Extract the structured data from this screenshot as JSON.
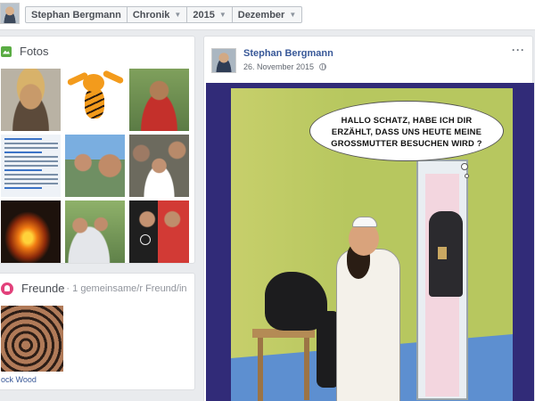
{
  "topbar": {
    "name": "Stephan Bergmann",
    "section": "Chronik",
    "year": "2015",
    "month": "Dezember"
  },
  "photos": {
    "title": "Fotos",
    "tiles": [
      "photo-portrait",
      "photo-tigger",
      "photo-red-shirt",
      "photo-tweet",
      "photo-selfie",
      "photo-group",
      "photo-fire",
      "photo-group-outdoor",
      "photo-two-men"
    ]
  },
  "friends": {
    "title": "Freunde",
    "meta": "· 1 gemeinsame/r Freund/in",
    "friend_name": "ock Wood"
  },
  "post": {
    "author": "Stephan Bergmann",
    "date": "26. November 2015",
    "more": "···",
    "bubble_text": "HALLO SCHATZ, HABE ICH DIR ERZÄHLT, DASS UNS HEUTE MEINE GROSSMUTTER BESUCHEN WIRD ?"
  },
  "icons": {
    "photos": "photos-icon",
    "friends": "friends-icon",
    "privacy": "globe-icon",
    "menu": "more-options-icon"
  },
  "colors": {
    "link_blue": "#385898",
    "page_bg": "#e9ebee",
    "photos_green": "#5aac43",
    "friends_pink": "#e2417b",
    "cartoon_border": "#312b78"
  }
}
